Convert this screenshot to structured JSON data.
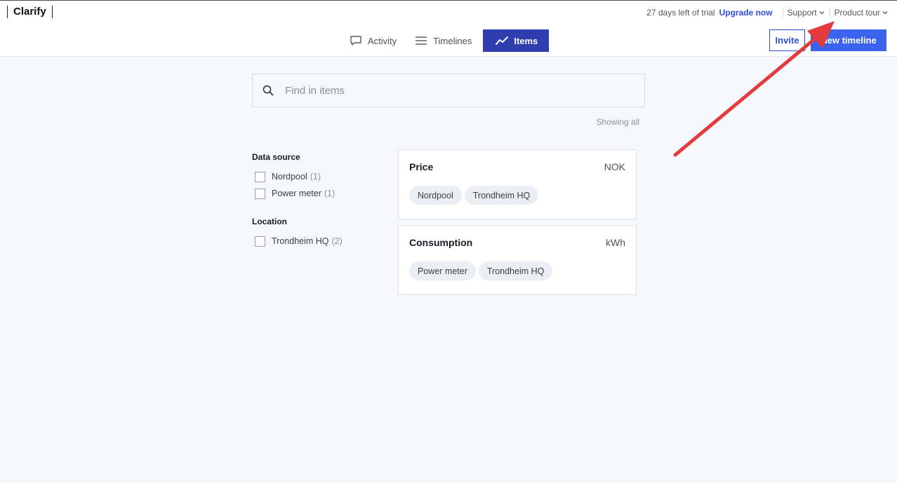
{
  "app": {
    "logo": "Clarify"
  },
  "header": {
    "trial_text": "27 days left of trial",
    "upgrade_label": "Upgrade now",
    "support_label": "Support",
    "product_tour_label": "Product tour"
  },
  "nav": {
    "tabs": [
      {
        "label": "Activity",
        "icon": "chat-bubble-icon",
        "active": false
      },
      {
        "label": "Timelines",
        "icon": "list-icon",
        "active": false
      },
      {
        "label": "Items",
        "icon": "trend-line-icon",
        "active": true
      }
    ]
  },
  "actions": {
    "invite_label": "Invite",
    "new_timeline_label": "New timeline"
  },
  "search": {
    "placeholder": "Find in items",
    "value": ""
  },
  "results": {
    "showing_label": "Showing all"
  },
  "filters": {
    "data_source": {
      "title": "Data source",
      "options": [
        {
          "label": "Nordpool",
          "count": "(1)",
          "checked": false
        },
        {
          "label": "Power meter",
          "count": "(1)",
          "checked": false
        }
      ]
    },
    "location": {
      "title": "Location",
      "options": [
        {
          "label": "Trondheim HQ",
          "count": "(2)",
          "checked": false
        }
      ]
    }
  },
  "items": [
    {
      "name": "Price",
      "unit": "NOK",
      "tags": [
        "Nordpool",
        "Trondheim HQ"
      ]
    },
    {
      "name": "Consumption",
      "unit": "kWh",
      "tags": [
        "Power meter",
        "Trondheim HQ"
      ]
    }
  ],
  "colors": {
    "accent": "#2c4fe0",
    "active_tab": "#2e3eae",
    "primary_button": "#3a63f0",
    "annotation_arrow": "#e53a3e",
    "background": "#f7f8fd"
  }
}
